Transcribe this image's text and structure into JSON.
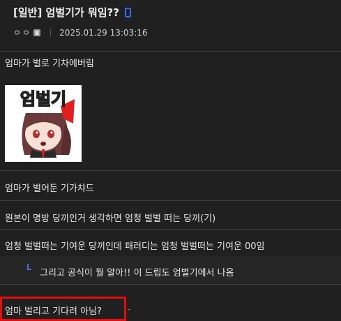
{
  "post": {
    "title": "[일반] 엄벌기가 뭐임??",
    "author": "ㅇㅇ",
    "date": "2025.01.29 13:03:16",
    "icons": {
      "device": "mobile-phone-icon",
      "member": "member-badge-icon"
    },
    "accent_color": "#3a6ee8"
  },
  "body": {
    "text": "엄마가 벌로 기차에버림",
    "sticker_text": "엄벌기"
  },
  "comments": [
    {
      "text": "엄마가 벌어둔 기가챠드"
    },
    {
      "text": "원본이 명방 당끼인거 생각하면 엄청 벌벌 떠는 당끼(기)"
    },
    {
      "text": "엄청 벌벌떠는 기여운 당끼인데 패러디는 엄청 벌벌떠는 기여운 00임"
    },
    {
      "text": "그리고 공식이 뭘 알아!! 이 드립도 엄벌기에서 나옴",
      "reply": true
    },
    {
      "text": "엄마 벌리고 기다려 아님?",
      "highlighted": true,
      "highlight_color": "#e10f0f"
    }
  ]
}
